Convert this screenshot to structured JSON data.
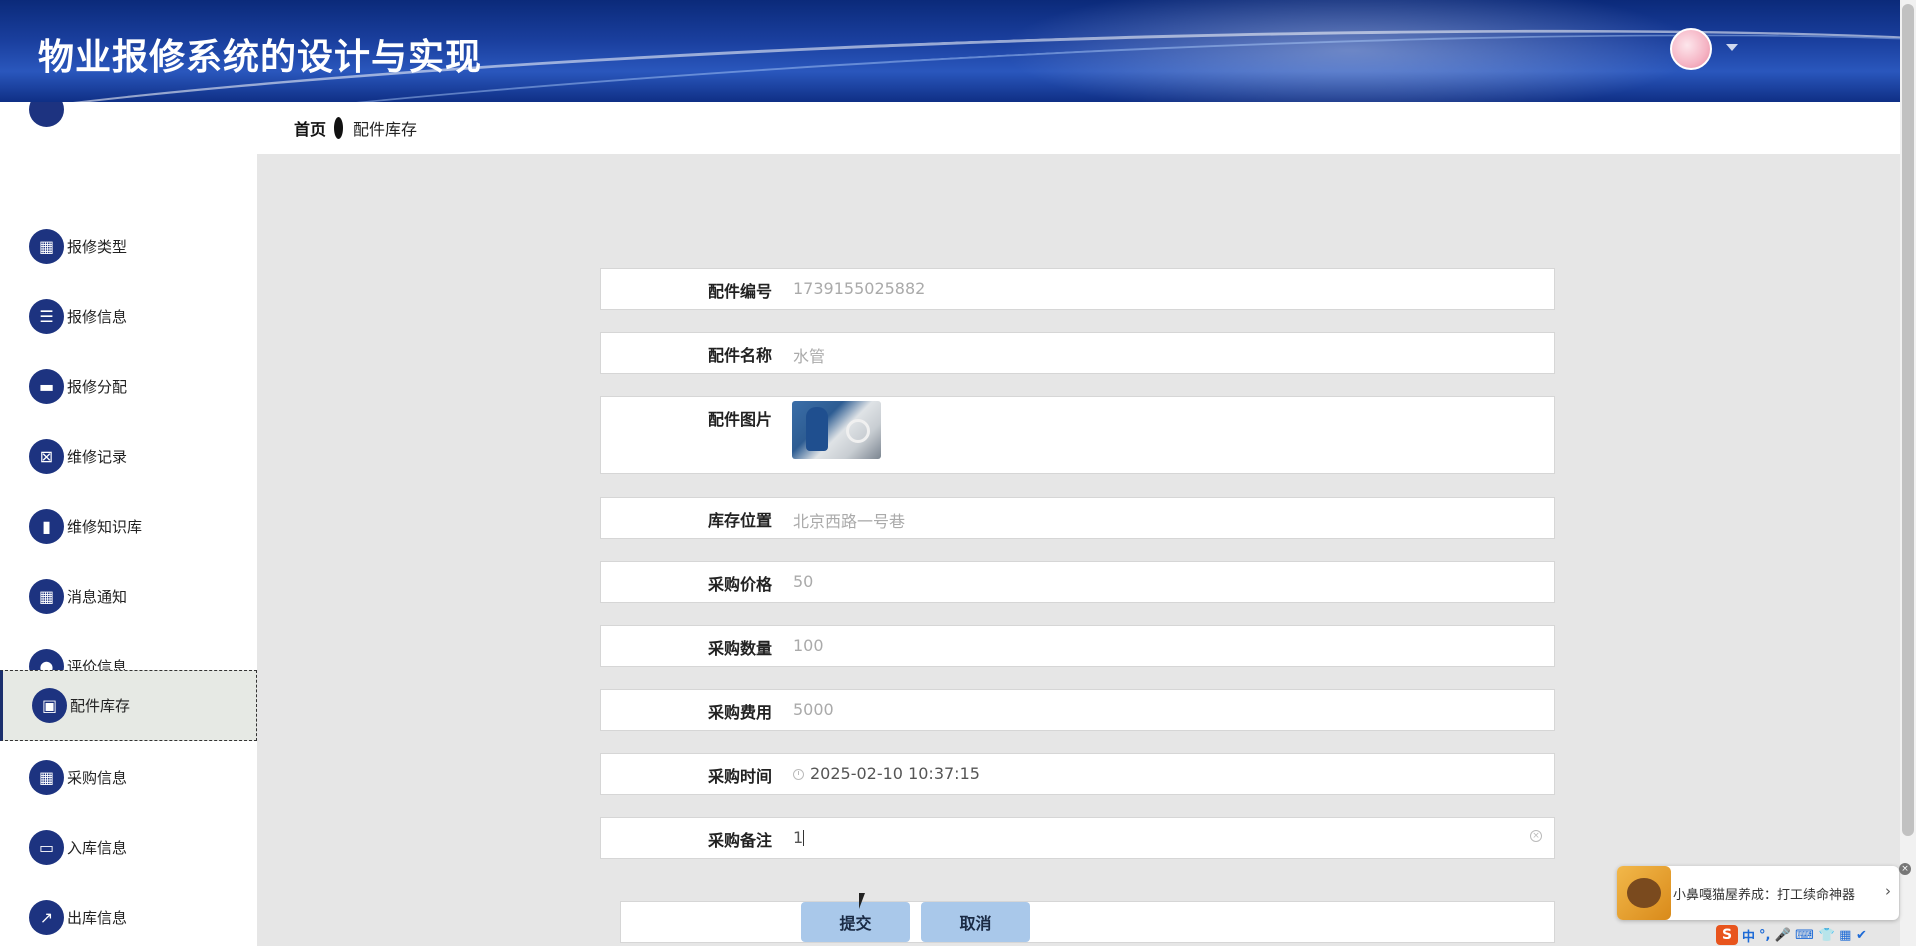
{
  "header": {
    "title": "物业报修系统的设计与实现"
  },
  "breadcrumb": {
    "home": "首页",
    "current": "配件库存"
  },
  "sidebar": {
    "items": [
      {
        "label": "",
        "icon": "partial-icon"
      },
      {
        "label": "报修类型",
        "icon": "grid-icon"
      },
      {
        "label": "报修信息",
        "icon": "list-icon"
      },
      {
        "label": "报修分配",
        "icon": "printer-icon"
      },
      {
        "label": "维修记录",
        "icon": "clipboard-icon"
      },
      {
        "label": "维修知识库",
        "icon": "brush-icon"
      },
      {
        "label": "消息通知",
        "icon": "grid-icon"
      },
      {
        "label": "评价信息",
        "icon": "bulb-icon"
      },
      {
        "label": "配件库存",
        "icon": "wallet-icon",
        "active": true
      },
      {
        "label": "采购信息",
        "icon": "grid-icon"
      },
      {
        "label": "入库信息",
        "icon": "monitor-icon"
      },
      {
        "label": "出库信息",
        "icon": "chart-icon"
      }
    ]
  },
  "form": {
    "code": {
      "label": "配件编号",
      "value": "1739155025882"
    },
    "name": {
      "label": "配件名称",
      "value": "水管"
    },
    "image": {
      "label": "配件图片"
    },
    "location": {
      "label": "库存位置",
      "value": "北京西路一号巷"
    },
    "price": {
      "label": "采购价格",
      "value": "50"
    },
    "qty": {
      "label": "采购数量",
      "value": "100"
    },
    "cost": {
      "label": "采购费用",
      "value": "5000"
    },
    "time": {
      "label": "采购时间",
      "value": "2025-02-10 10:37:15"
    },
    "remark": {
      "label": "采购备注",
      "value": "1"
    }
  },
  "buttons": {
    "submit": "提交",
    "cancel": "取消"
  },
  "ad": {
    "text": "小鼻嘎猫屋养成：打工续命神器",
    "arrow": "›",
    "close": "×"
  },
  "ime": {
    "logo": "S",
    "lang": "中",
    "punct": "°,",
    "extras": "🎤 ⌨ 👕 ▦ ✔"
  }
}
